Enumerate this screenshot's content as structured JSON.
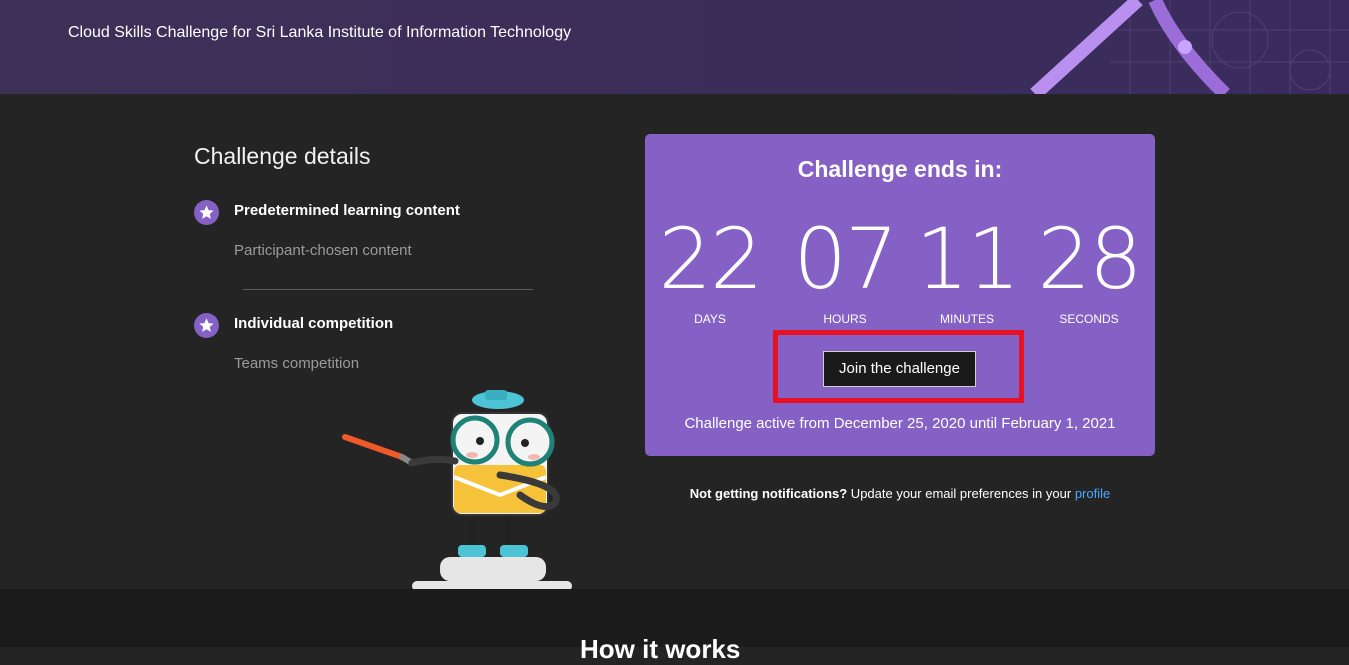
{
  "banner": {
    "title": "Cloud Skills Challenge for Sri Lanka Institute of Information Technology"
  },
  "details": {
    "heading": "Challenge details",
    "items": [
      {
        "primary": "Predetermined learning content",
        "secondary": "Participant-chosen content",
        "icon": "star-icon"
      },
      {
        "primary": "Individual competition",
        "secondary": "Teams competition",
        "icon": "star-icon"
      }
    ]
  },
  "countdown": {
    "title": "Challenge ends in:",
    "units": [
      {
        "value": "22",
        "label": "DAYS"
      },
      {
        "value": "07",
        "label": "HOURS"
      },
      {
        "value": "11",
        "label": "MINUTES"
      },
      {
        "value": "28",
        "label": "SECONDS"
      }
    ],
    "join_label": "Join the challenge",
    "active_dates": "Challenge active from December 25, 2020 until February 1, 2021"
  },
  "notifications": {
    "lead": "Not getting notifications?",
    "text": " Update your email preferences in your ",
    "link": "profile"
  },
  "next_section": {
    "heading_peek": "How it works"
  },
  "colors": {
    "banner_bg": "#3b2d5a",
    "accent_purple": "#8661c5",
    "page_bg": "#242424",
    "highlight_red": "#e81123",
    "link_blue": "#4aa8ff"
  }
}
